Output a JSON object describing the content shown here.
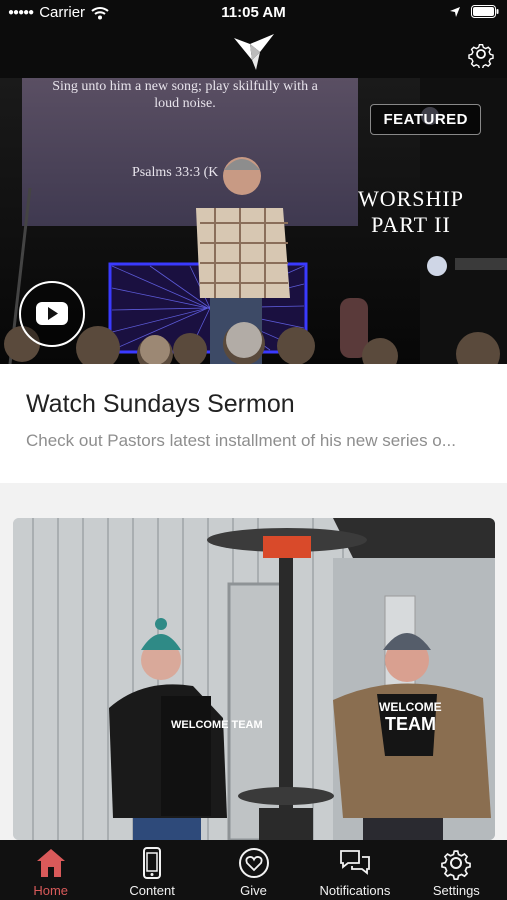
{
  "status_bar": {
    "carrier": "Carrier",
    "time": "11:05 AM"
  },
  "top_nav": {
    "logo_icon": "origami-bird-logo",
    "settings_icon": "gear-icon"
  },
  "featured_card": {
    "badge": "FEATURED",
    "hero": {
      "screen_line_1": "Sing unto him a new song; play skilfully with a",
      "screen_line_2": "loud noise.",
      "screen_reference": "Psalms 33:3 (K",
      "overlay_title_1": "WORSHIP",
      "overlay_title_2": "PART II",
      "video_icon": "youtube-play-icon"
    },
    "title": "Watch Sundays Sermon",
    "description": "Check out Pastors latest installment of his new series o..."
  },
  "second_card": {
    "shirt_text_left": "WELCOME TEAM",
    "shirt_text_right_1": "WELCOME",
    "shirt_text_right_2": "TEAM"
  },
  "tab_bar": {
    "active_color": "#d95a5a",
    "tabs": [
      {
        "label": "Home",
        "icon": "home-icon",
        "active": true
      },
      {
        "label": "Content",
        "icon": "phone-icon",
        "active": false
      },
      {
        "label": "Give",
        "icon": "heart-circle-icon",
        "active": false
      },
      {
        "label": "Notifications",
        "icon": "chat-bubbles-icon",
        "active": false
      },
      {
        "label": "Settings",
        "icon": "gear-icon",
        "active": false
      }
    ]
  }
}
